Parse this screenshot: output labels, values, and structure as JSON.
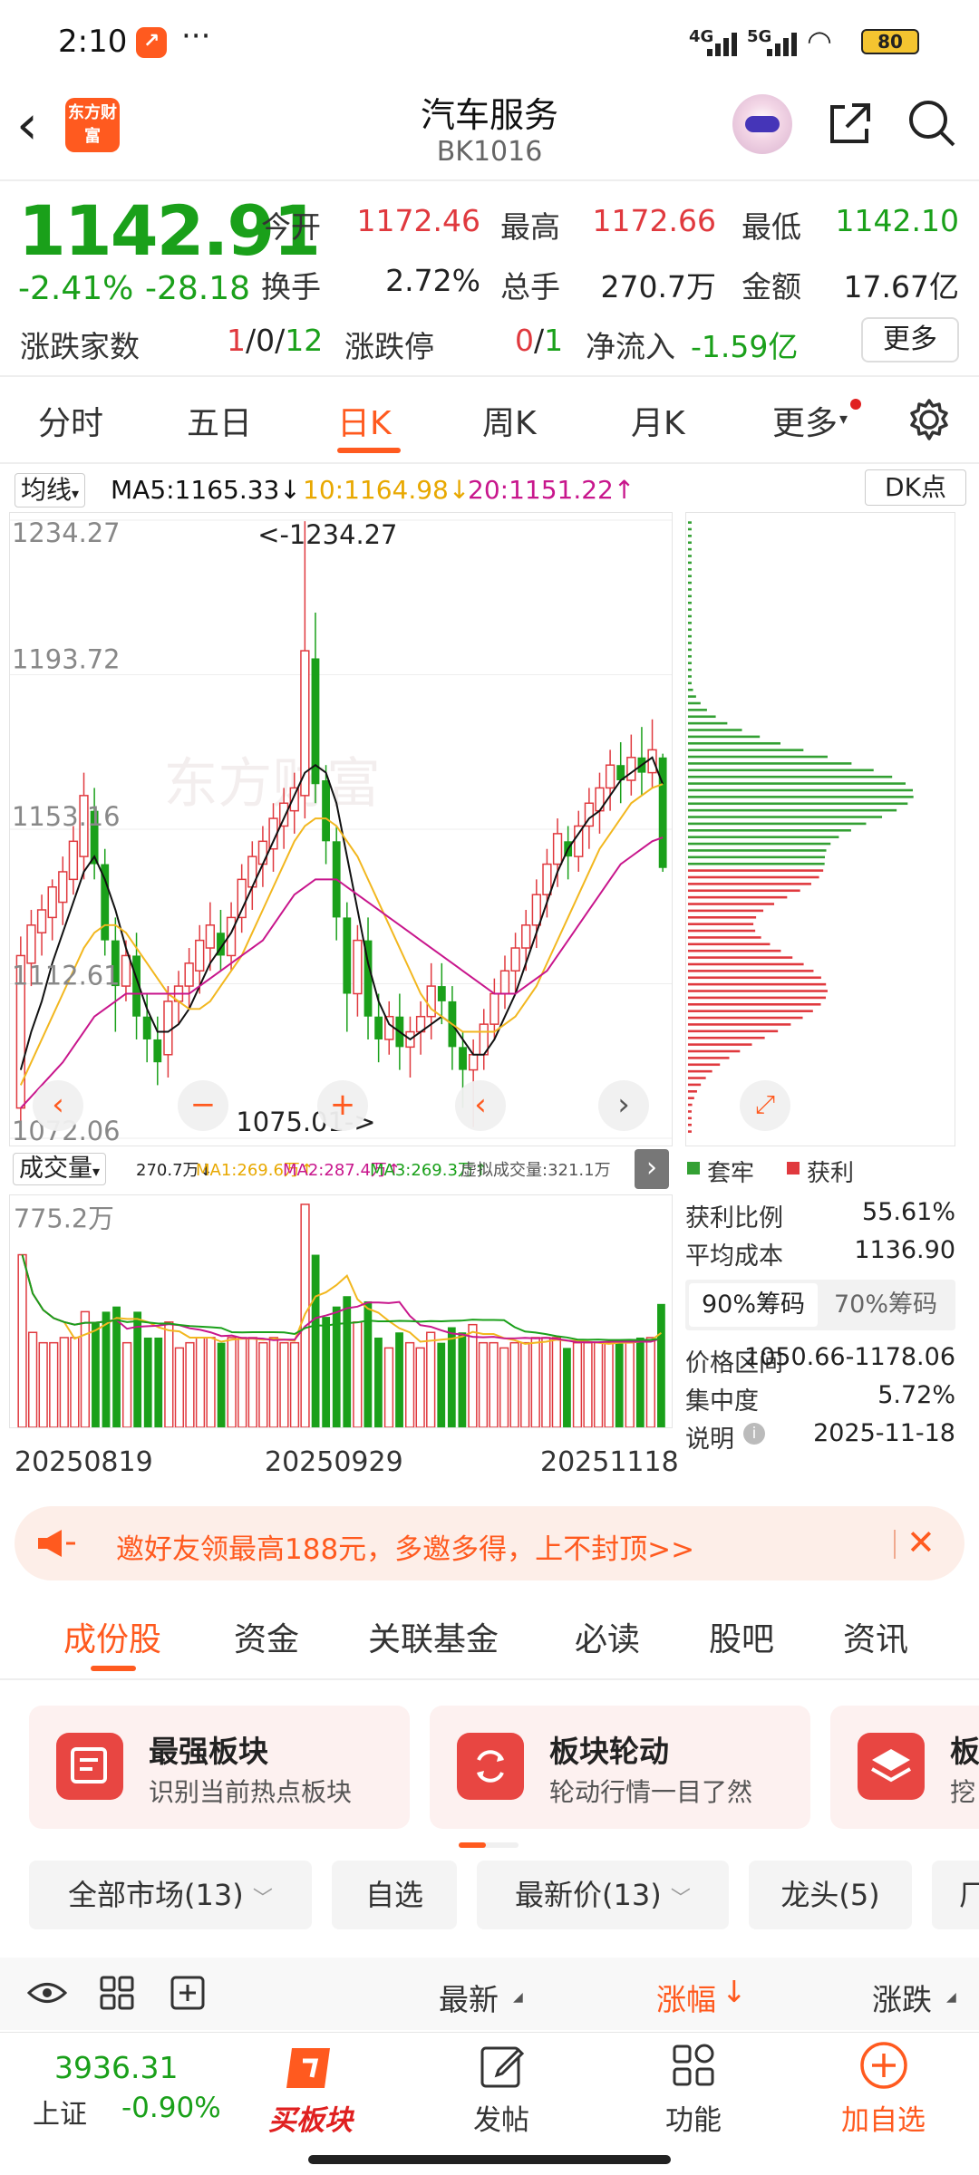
{
  "status_bar": {
    "time": "2:10",
    "dots": "···",
    "net4g": "4G",
    "net5g": "5G",
    "battery": "80"
  },
  "header": {
    "logo": "东方财富",
    "title": "汽车服务",
    "code": "BK1016"
  },
  "quote": {
    "price": "1142.91",
    "change_pct": "-2.41%",
    "change_val": "-28.18",
    "open_label": "今开",
    "open": "1172.46",
    "high_label": "最高",
    "high": "1172.66",
    "low_label": "最低",
    "low": "1142.10",
    "turnover_label": "换手",
    "turnover": "2.72%",
    "volume_label": "总手",
    "volume": "270.7万",
    "amount_label": "金额",
    "amount": "17.67亿",
    "breadth_label": "涨跌家数",
    "breadth_up": "1",
    "breadth_flat": "/0/",
    "breadth_down": "12",
    "limit_label": "涨跌停",
    "limit_up": "0",
    "limit_sep": "/",
    "limit_down": "1",
    "netflow_label": "净流入",
    "netflow": "-1.59亿",
    "more": "更多"
  },
  "period_tabs": [
    "分时",
    "五日",
    "日K",
    "周K",
    "月K",
    "更多"
  ],
  "ma": {
    "selector": "均线",
    "ma5": "MA5:1165.33↓",
    "ma10": "10:1164.98↓",
    "ma20": "20:1151.22↑",
    "dk": "DK点"
  },
  "chart_labels": {
    "y_ticks": [
      "1234.27",
      "1193.72",
      "1153.16",
      "1112.61",
      "1072.06"
    ],
    "max_note": "<-1234.27",
    "min_note": "1075.01->",
    "volume_top": "775.2万",
    "x_labels": [
      "20250819",
      "20250929",
      "20251118"
    ]
  },
  "volume_bar": {
    "selector": "成交量",
    "vol": "270.7万↓",
    "ma1": "MA1:269.6万↑",
    "ma2": "MA2:287.4万↑",
    "ma3": "MA3:269.3万↑",
    "virtual": "虚拟成交量:321.1万"
  },
  "colors": {
    "up": "#e0393e",
    "down": "#1aa01a",
    "ma5": "#111111",
    "ma10": "#f2b71f",
    "ma20": "#c8168c",
    "accent": "#ff5a1f"
  },
  "chips": {
    "legend_trapped": "套牢",
    "legend_profit": "获利",
    "profit_ratio_label": "获利比例",
    "profit_ratio": "55.61%",
    "avg_cost_label": "平均成本",
    "avg_cost": "1136.90",
    "tab90": "90%筹码",
    "tab70": "70%筹码",
    "range_label": "价格区间",
    "range": "1050.66-1178.06",
    "concentration_label": "集中度",
    "concentration": "5.72%",
    "note_label": "说明",
    "note_date": "2025-11-18"
  },
  "banner": {
    "text": "邀好友领最高188元，多邀多得，上不封顶>>"
  },
  "bottom_tabs": [
    "成份股",
    "资金",
    "关联基金",
    "必读",
    "股吧",
    "资讯"
  ],
  "cards": [
    {
      "title": "最强板块",
      "sub": "识别当前热点板块"
    },
    {
      "title": "板块轮动",
      "sub": "轮动行情一目了然"
    },
    {
      "title": "板",
      "sub": "挖"
    }
  ],
  "filters": [
    "全部市场(13)",
    "自选",
    "最新价(13)",
    "龙头(5)",
    "厂"
  ],
  "list_header": {
    "latest": "最新",
    "pct": "涨幅",
    "chg": "涨跌"
  },
  "nav": {
    "index_value": "3936.31",
    "index_name": "上证",
    "index_change": "-0.90%",
    "buy": "买板块",
    "post": "发帖",
    "func": "功能",
    "add": "加自选"
  },
  "chart_data": {
    "type": "candlestick",
    "ylim": [
      1072.06,
      1234.27
    ],
    "y_ticks": [
      1234.27,
      1193.72,
      1153.16,
      1112.61,
      1072.06
    ],
    "x_labels": [
      "20250819",
      "20250929",
      "20251118"
    ],
    "candles": [
      [
        1080,
        1120,
        1075,
        1125
      ],
      [
        1118,
        1128,
        1112,
        1132
      ],
      [
        1126,
        1132,
        1120,
        1136
      ],
      [
        1130,
        1138,
        1124,
        1140
      ],
      [
        1134,
        1142,
        1128,
        1146
      ],
      [
        1140,
        1150,
        1136,
        1154
      ],
      [
        1146,
        1162,
        1140,
        1168
      ],
      [
        1158,
        1144,
        1140,
        1164
      ],
      [
        1144,
        1124,
        1120,
        1148
      ],
      [
        1124,
        1112,
        1100,
        1130
      ],
      [
        1112,
        1120,
        1108,
        1124
      ],
      [
        1120,
        1104,
        1098,
        1126
      ],
      [
        1104,
        1098,
        1092,
        1110
      ],
      [
        1098,
        1092,
        1086,
        1104
      ],
      [
        1094,
        1108,
        1088,
        1112
      ],
      [
        1108,
        1112,
        1102,
        1116
      ],
      [
        1112,
        1118,
        1106,
        1122
      ],
      [
        1116,
        1124,
        1110,
        1128
      ],
      [
        1122,
        1128,
        1116,
        1134
      ],
      [
        1126,
        1120,
        1116,
        1132
      ],
      [
        1120,
        1130,
        1116,
        1134
      ],
      [
        1130,
        1140,
        1126,
        1144
      ],
      [
        1138,
        1146,
        1132,
        1150
      ],
      [
        1144,
        1150,
        1138,
        1154
      ],
      [
        1148,
        1156,
        1142,
        1160
      ],
      [
        1154,
        1160,
        1148,
        1164
      ],
      [
        1158,
        1164,
        1152,
        1168
      ],
      [
        1162,
        1200,
        1156,
        1234
      ],
      [
        1198,
        1165,
        1160,
        1210
      ],
      [
        1166,
        1150,
        1144,
        1170
      ],
      [
        1150,
        1130,
        1124,
        1154
      ],
      [
        1130,
        1110,
        1100,
        1134
      ],
      [
        1110,
        1124,
        1104,
        1128
      ],
      [
        1124,
        1104,
        1098,
        1130
      ],
      [
        1104,
        1098,
        1092,
        1110
      ],
      [
        1098,
        1104,
        1094,
        1108
      ],
      [
        1104,
        1096,
        1090,
        1110
      ],
      [
        1096,
        1100,
        1088,
        1104
      ],
      [
        1100,
        1104,
        1094,
        1108
      ],
      [
        1104,
        1112,
        1098,
        1118
      ],
      [
        1112,
        1108,
        1102,
        1118
      ],
      [
        1108,
        1096,
        1090,
        1112
      ],
      [
        1096,
        1090,
        1080,
        1100
      ],
      [
        1090,
        1094,
        1075,
        1098
      ],
      [
        1094,
        1102,
        1090,
        1106
      ],
      [
        1102,
        1110,
        1098,
        1114
      ],
      [
        1110,
        1116,
        1106,
        1120
      ],
      [
        1116,
        1122,
        1110,
        1126
      ],
      [
        1122,
        1128,
        1116,
        1132
      ],
      [
        1128,
        1136,
        1122,
        1140
      ],
      [
        1136,
        1144,
        1130,
        1148
      ],
      [
        1144,
        1152,
        1138,
        1156
      ],
      [
        1150,
        1146,
        1140,
        1154
      ],
      [
        1146,
        1154,
        1142,
        1158
      ],
      [
        1154,
        1160,
        1148,
        1164
      ],
      [
        1158,
        1164,
        1152,
        1168
      ],
      [
        1164,
        1170,
        1158,
        1174
      ],
      [
        1170,
        1166,
        1160,
        1176
      ],
      [
        1166,
        1172,
        1162,
        1178
      ],
      [
        1172,
        1168,
        1162,
        1180
      ],
      [
        1168,
        1174,
        1164,
        1182
      ],
      [
        1172,
        1143,
        1142,
        1173
      ]
    ],
    "series": [
      {
        "name": "MA5",
        "values": [
          1090,
          1100,
          1108,
          1118,
          1126,
          1134,
          1142,
          1146,
          1140,
          1132,
          1122,
          1114,
          1106,
          1100,
          1100,
          1102,
          1106,
          1112,
          1118,
          1122,
          1126,
          1132,
          1138,
          1144,
          1150,
          1156,
          1162,
          1168,
          1170,
          1168,
          1160,
          1146,
          1132,
          1118,
          1108,
          1102,
          1100,
          1098,
          1100,
          1102,
          1104,
          1102,
          1098,
          1094,
          1094,
          1098,
          1104,
          1110,
          1118,
          1126,
          1134,
          1142,
          1148,
          1152,
          1156,
          1158,
          1162,
          1166,
          1168,
          1170,
          1172,
          1165
        ]
      },
      {
        "name": "10",
        "values": [
          1086,
          1092,
          1098,
          1104,
          1110,
          1116,
          1122,
          1126,
          1128,
          1128,
          1126,
          1122,
          1118,
          1114,
          1110,
          1108,
          1106,
          1106,
          1108,
          1112,
          1116,
          1120,
          1126,
          1132,
          1138,
          1144,
          1150,
          1154,
          1156,
          1156,
          1154,
          1150,
          1146,
          1140,
          1134,
          1128,
          1122,
          1116,
          1110,
          1106,
          1104,
          1102,
          1100,
          1100,
          1100,
          1100,
          1102,
          1104,
          1108,
          1112,
          1118,
          1124,
          1130,
          1136,
          1142,
          1148,
          1152,
          1156,
          1160,
          1162,
          1164,
          1165
        ]
      },
      {
        "name": "20",
        "values": [
          1080,
          1083,
          1086,
          1089,
          1092,
          1096,
          1100,
          1104,
          1106,
          1108,
          1110,
          1110,
          1110,
          1110,
          1110,
          1110,
          1110,
          1112,
          1114,
          1116,
          1118,
          1120,
          1122,
          1124,
          1128,
          1132,
          1136,
          1138,
          1140,
          1140,
          1140,
          1138,
          1136,
          1134,
          1132,
          1130,
          1128,
          1126,
          1124,
          1122,
          1120,
          1118,
          1116,
          1114,
          1112,
          1110,
          1110,
          1110,
          1112,
          1114,
          1116,
          1120,
          1124,
          1128,
          1132,
          1136,
          1140,
          1144,
          1146,
          1148,
          1150,
          1151
        ]
      }
    ],
    "volume": {
      "ylim": [
        0,
        775.2
      ]
    }
  }
}
